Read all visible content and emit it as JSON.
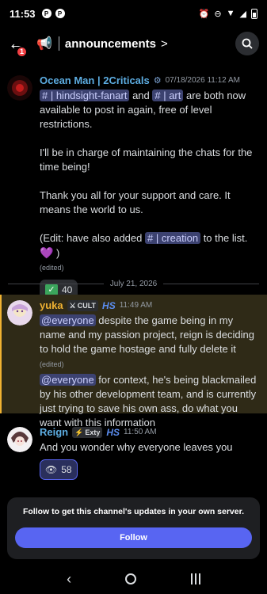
{
  "status_bar": {
    "time": "11:53",
    "notification_icons": [
      "pinterest-icon",
      "pinterest-icon"
    ],
    "status_icons": [
      "alarm-icon",
      "dnd-icon",
      "wifi-icon",
      "signal-icon",
      "battery-icon"
    ]
  },
  "header": {
    "badge_count": "1",
    "channel_title": "announcements",
    "chevron": ">"
  },
  "messages": [
    {
      "author": "Ocean Man | 2Criticals",
      "author_color": "#5dade2",
      "timestamp": "07/18/2026 11:12 AM",
      "channel1": "# | hindsight-fanart",
      "and_text": " and ",
      "channel2": "# | art",
      "line1_rest": " are both now available to post in again, free of level restrictions.",
      "para2": "I'll be in charge of maintaining the chats for the time being!",
      "para3": "Thank you all for your support and care. It means the world to us.",
      "para4_pre": "(Edit: have also added ",
      "channel3": "# | creation",
      "para4_post": " to the list. ",
      "para4_end": " )",
      "edited": "(edited)",
      "reaction_count": "40"
    },
    {
      "author": "yuka",
      "author_color": "#f0b232",
      "tag": "CULT",
      "tag_icon": "sword-icon",
      "hs_badge": "HS",
      "timestamp": "11:49 AM",
      "mention": "@everyone",
      "text1": " despite the game being in my name and my passion project, reign is deciding to hold the game hostage and fully delete it ",
      "edited": "(edited)",
      "text2": " for context, he's being blackmailed by his other development team, and is currently just trying to save his own ass, do what you want with this information"
    },
    {
      "author": "Reign",
      "author_color": "#5dade2",
      "tag": "Exty",
      "tag_icon": "lightning-icon",
      "hs_badge": "HS",
      "timestamp": "11:50 AM",
      "text": "And you wonder why everyone leaves you",
      "reaction_count": "58"
    }
  ],
  "date_separator": "July 21, 2026",
  "follow_card": {
    "text": "Follow to get this channel's updates in your own server.",
    "button": "Follow"
  }
}
